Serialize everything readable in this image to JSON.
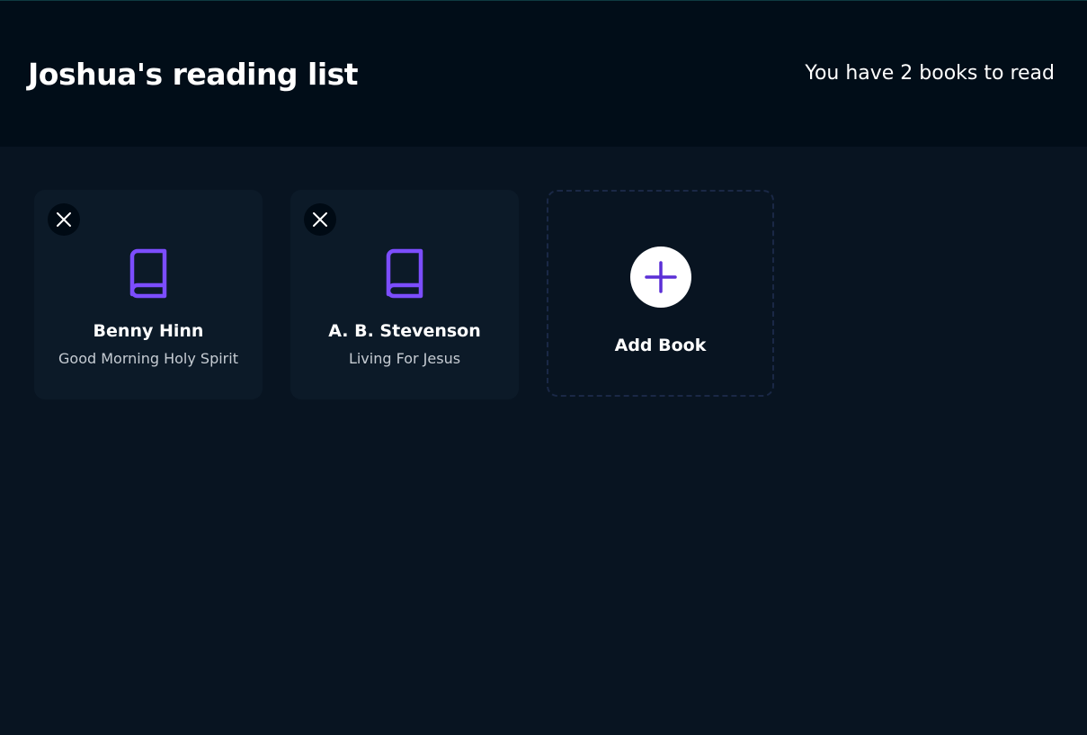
{
  "header": {
    "title": "Joshua's reading list",
    "count_text": "You have 2 books to read"
  },
  "books": [
    {
      "author": "Benny Hinn",
      "title": "Good Morning Holy Spirit"
    },
    {
      "author": "A. B. Stevenson",
      "title": "Living For Jesus"
    }
  ],
  "add_card": {
    "label": "Add Book"
  },
  "icons": {
    "remove": "close-icon",
    "book": "book-icon",
    "add": "plus-icon"
  },
  "colors": {
    "accent": "#7c4dff",
    "header_bg": "#010d18",
    "page_bg": "#081421",
    "card_bg": "#0c1a28"
  }
}
